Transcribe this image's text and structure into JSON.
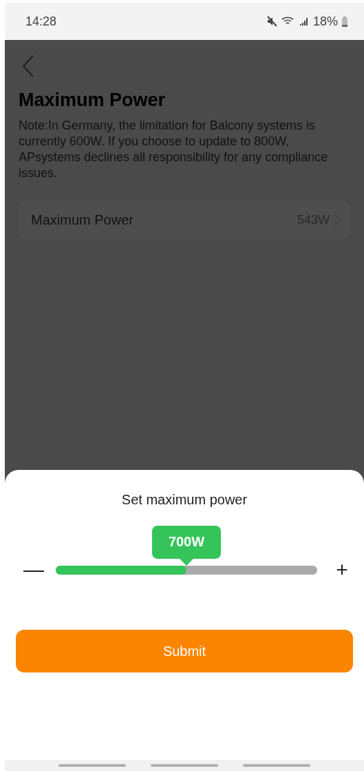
{
  "status_bar": {
    "time": "14:28",
    "battery": "18%"
  },
  "page": {
    "title": "Maximum Power",
    "note": "Note:In Germany, the limitation for Balcony systems is currently 600W. If you choose to update to 800W, APsystems declines all responsibility for any compliance issues.",
    "setting": {
      "label": "Maximum Power",
      "value": "543W"
    }
  },
  "sheet": {
    "title": "Set maximum power",
    "slider": {
      "reading": "700W",
      "level": 0.5,
      "minus": "—",
      "plus": "+"
    },
    "button": "Submit"
  }
}
